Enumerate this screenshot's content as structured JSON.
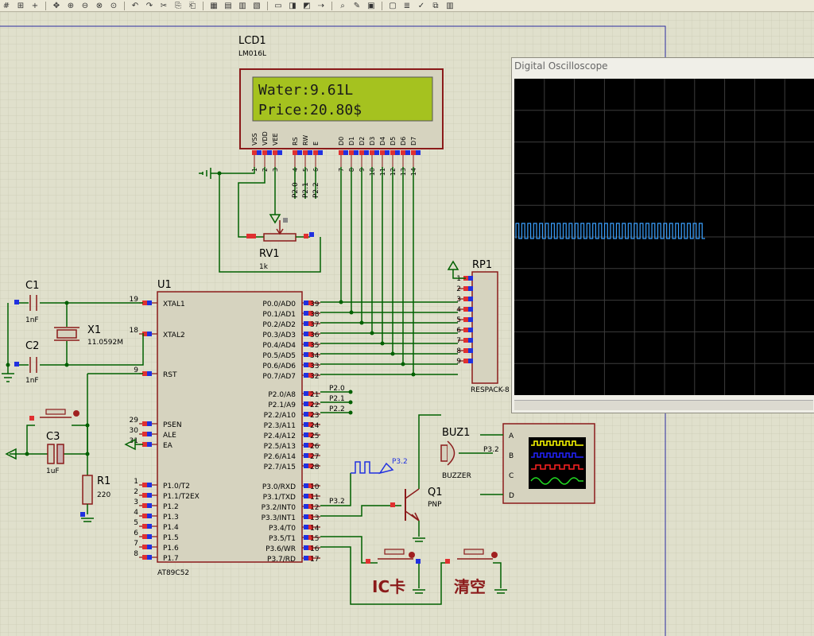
{
  "toolbar": {
    "icons": [
      "grid-icon",
      "snap-icon",
      "origin-icon",
      "pan-icon",
      "zoom-in-icon",
      "zoom-out-icon",
      "zoom-all-icon",
      "zoom-area-icon",
      "undo-icon",
      "redo-icon",
      "cut-icon",
      "copy-icon",
      "paste-icon",
      "block-copy-icon",
      "block-move-icon",
      "block-rotate-icon",
      "block-delete-icon",
      "pick-device-icon",
      "make-device-icon",
      "decompose-icon",
      "wire-autoroute-icon",
      "search-icon",
      "property-tool-icon",
      "new-sheet-icon",
      "remove-sheet-icon",
      "bom-icon",
      "erc-icon",
      "netlist-icon",
      "ares-icon"
    ]
  },
  "lcd": {
    "ref": "LCD1",
    "model": "LM016L",
    "line1": "Water:9.61L",
    "line2": "Price:20.80$",
    "pin_names": [
      "VSS",
      "VDD",
      "VEE",
      "RS",
      "RW",
      "E",
      "D0",
      "D1",
      "D2",
      "D3",
      "D4",
      "D5",
      "D6",
      "D7"
    ],
    "pin_numbers": [
      "1",
      "2",
      "3",
      "4",
      "5",
      "6",
      "7",
      "8",
      "9",
      "10",
      "11",
      "12",
      "13",
      "14"
    ],
    "port_labels": [
      "P2.0",
      "P2.1",
      "P2.2"
    ],
    "colors": {
      "screen": "#a5c21f",
      "text": "#1a1a1a",
      "body": "#d6d3bf",
      "border": "#8b1a1a"
    }
  },
  "rv1": {
    "ref": "RV1",
    "value": "1k"
  },
  "rp1": {
    "ref": "RP1",
    "model": "RESPACK-8",
    "pins": [
      "1",
      "2",
      "3",
      "4",
      "5",
      "6",
      "7",
      "8",
      "9"
    ]
  },
  "u1": {
    "ref": "U1",
    "model": "AT89C52",
    "left_pins": [
      {
        "num": "19",
        "name": "XTAL1"
      },
      {
        "num": "18",
        "name": "XTAL2"
      },
      {
        "num": "9",
        "name": "RST"
      },
      {
        "num": "29",
        "name": "PSEN"
      },
      {
        "num": "30",
        "name": "ALE"
      },
      {
        "num": "31",
        "name": "EA"
      },
      {
        "num": "1",
        "name": "P1.0/T2"
      },
      {
        "num": "2",
        "name": "P1.1/T2EX"
      },
      {
        "num": "3",
        "name": "P1.2"
      },
      {
        "num": "4",
        "name": "P1.3"
      },
      {
        "num": "5",
        "name": "P1.4"
      },
      {
        "num": "6",
        "name": "P1.5"
      },
      {
        "num": "7",
        "name": "P1.6"
      },
      {
        "num": "8",
        "name": "P1.7"
      }
    ],
    "right_pins": [
      {
        "num": "39",
        "name": "P0.0/AD0"
      },
      {
        "num": "38",
        "name": "P0.1/AD1"
      },
      {
        "num": "37",
        "name": "P0.2/AD2"
      },
      {
        "num": "36",
        "name": "P0.3/AD3"
      },
      {
        "num": "35",
        "name": "P0.4/AD4"
      },
      {
        "num": "34",
        "name": "P0.5/AD5"
      },
      {
        "num": "33",
        "name": "P0.6/AD6"
      },
      {
        "num": "32",
        "name": "P0.7/AD7"
      },
      {
        "num": "21",
        "name": "P2.0/A8"
      },
      {
        "num": "22",
        "name": "P2.1/A9"
      },
      {
        "num": "23",
        "name": "P2.2/A10"
      },
      {
        "num": "24",
        "name": "P2.3/A11"
      },
      {
        "num": "25",
        "name": "P2.4/A12"
      },
      {
        "num": "26",
        "name": "P2.5/A13"
      },
      {
        "num": "27",
        "name": "P2.6/A14"
      },
      {
        "num": "28",
        "name": "P2.7/A15"
      },
      {
        "num": "10",
        "name": "P3.0/RXD"
      },
      {
        "num": "11",
        "name": "P3.1/TXD"
      },
      {
        "num": "12",
        "name": "P3.2/INT0"
      },
      {
        "num": "13",
        "name": "P3.3/INT1"
      },
      {
        "num": "14",
        "name": "P3.4/T0"
      },
      {
        "num": "15",
        "name": "P3.5/T1"
      },
      {
        "num": "16",
        "name": "P3.6/WR"
      },
      {
        "num": "17",
        "name": "P3.7/RD"
      }
    ],
    "net_labels": [
      "P2.0",
      "P2.1",
      "P2.2",
      "P3.2"
    ]
  },
  "c1": {
    "ref": "C1",
    "value": "1nF"
  },
  "c2": {
    "ref": "C2",
    "value": "1nF"
  },
  "c3": {
    "ref": "C3",
    "value": "1uF"
  },
  "x1": {
    "ref": "X1",
    "value": "11.0592M"
  },
  "r1": {
    "ref": "R1",
    "value": "220"
  },
  "buz1": {
    "ref": "BUZ1",
    "model": "BUZZER",
    "net": "P3.2"
  },
  "q1": {
    "ref": "Q1",
    "model": "PNP"
  },
  "probe": {
    "label": "P3.2"
  },
  "scope_inst": {
    "channels": [
      "A",
      "B",
      "C",
      "D"
    ],
    "trace_colors": [
      "#ffff00",
      "#2222ff",
      "#ff2222",
      "#22dd22"
    ]
  },
  "buttons": {
    "ic_card": "IC卡",
    "clear": "清空"
  },
  "oscilloscope": {
    "title": "Digital Oscilloscope",
    "trace_color": "#3aa0ff",
    "grid_color": "#3c3c3c",
    "pulse_count": 32
  },
  "colors": {
    "sheet_bg": "#e0e0cc",
    "grid": "#cfcfba",
    "wire": "#006000",
    "part_border": "#8b1a1a",
    "part_fill": "#d6d3bf",
    "pin_red": "#e03030",
    "pin_blue": "#2030e0",
    "text": "#000000",
    "label_red": "#8b1a1a"
  }
}
